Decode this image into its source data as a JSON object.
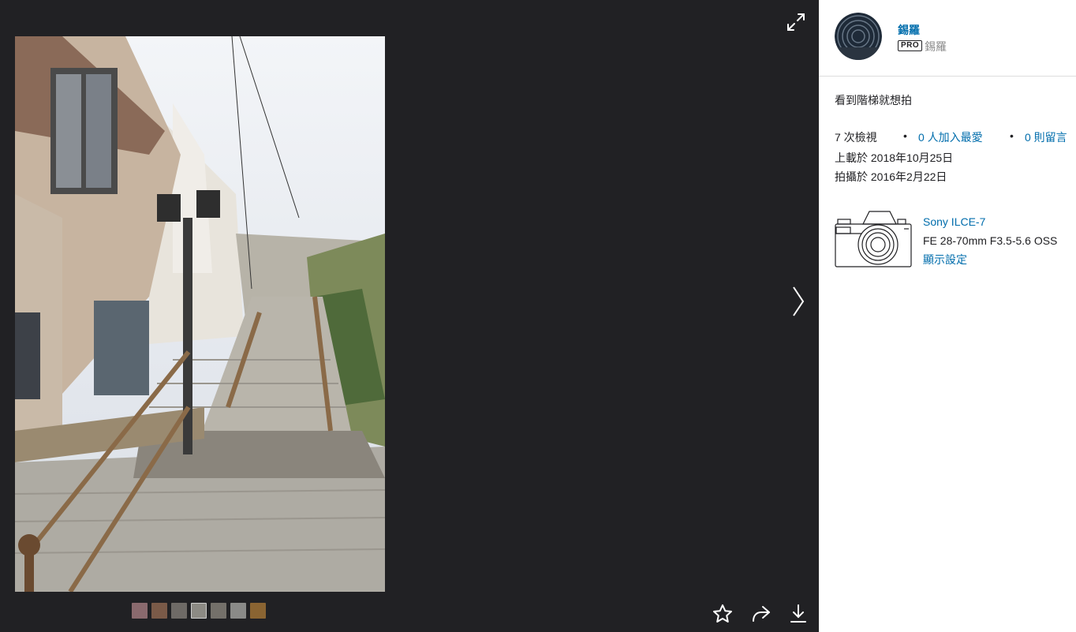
{
  "owner": {
    "name": "錫羅",
    "badge": "PRO",
    "real_name": "錫羅"
  },
  "photo": {
    "description": "看到階梯就想拍"
  },
  "stats": {
    "views": "7 次檢視",
    "bullet": "•",
    "faves": "0 人加入最愛",
    "comments": "0 則留言"
  },
  "dates": {
    "uploaded": "上載於 2018年10月25日",
    "taken": "拍攝於 2016年2月22日"
  },
  "camera": {
    "model": "Sony ILCE-7",
    "lens": "FE 28-70mm F3.5-5.6 OSS",
    "settings_link": "顯示設定"
  },
  "icons": {
    "expand": "expand-icon",
    "next": "chevron-right-icon",
    "fave": "star-icon",
    "share": "share-icon",
    "download": "download-icon",
    "camera": "camera-icon"
  },
  "filmstrip": {
    "thumbnail_colors": [
      "#8a6a6e",
      "#7a5a48",
      "#6e6a66",
      "#8c8a84",
      "#74706a",
      "#8a8a88",
      "#8a6432"
    ]
  },
  "colors": {
    "link": "#006dac",
    "viewer_background": "#212124",
    "panel_background": "#ffffff"
  }
}
